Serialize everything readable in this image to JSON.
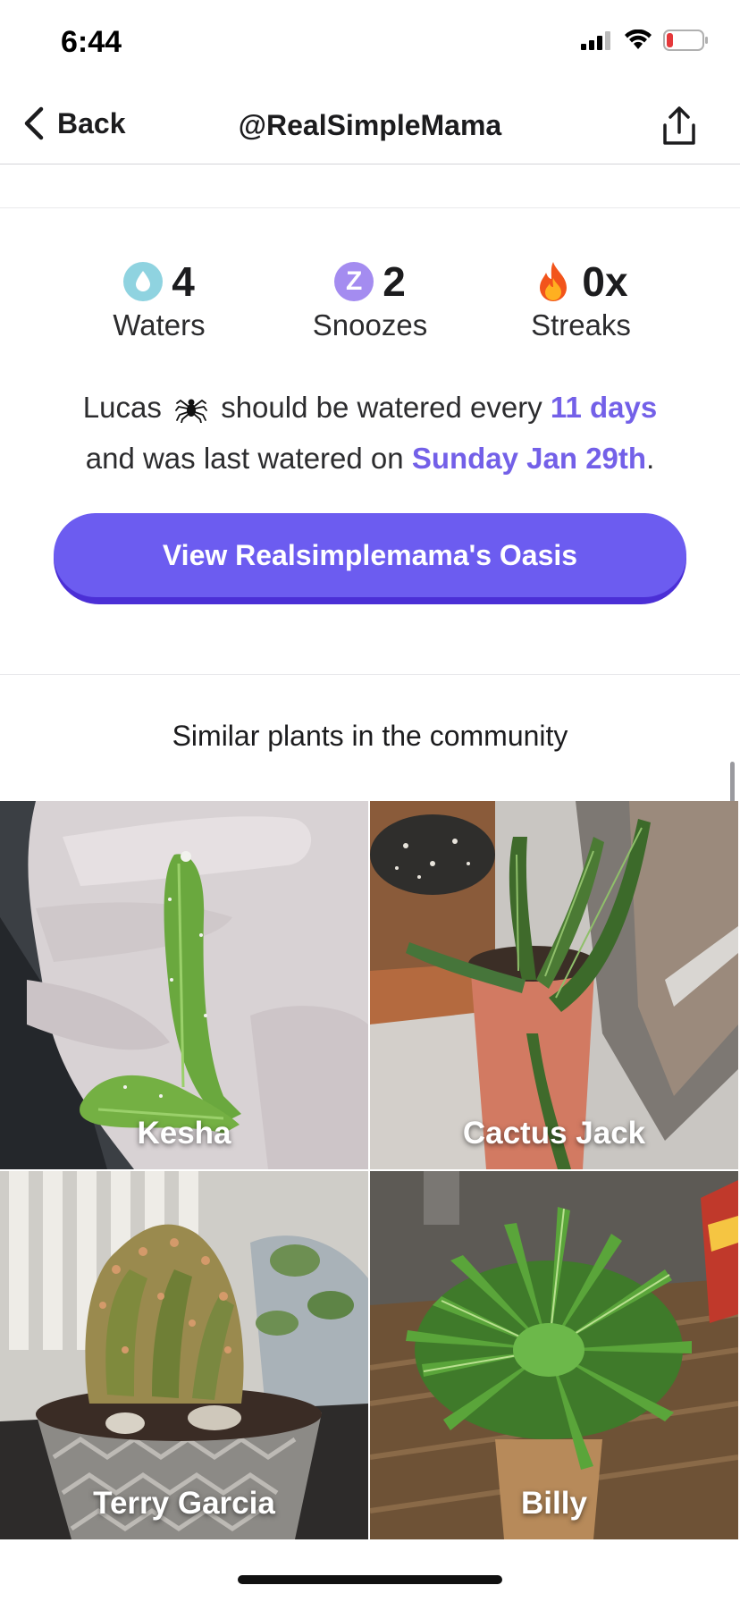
{
  "status_bar": {
    "time": "6:44"
  },
  "nav": {
    "back_label": "Back",
    "title": "@RealSimpleMama"
  },
  "stats": [
    {
      "value": "4",
      "label": "Waters",
      "icon": "water-drop-icon"
    },
    {
      "value": "2",
      "label": "Snoozes",
      "icon": "snooze-z-icon"
    },
    {
      "value": "0x",
      "label": "Streaks",
      "icon": "fire-icon"
    }
  ],
  "description": {
    "plant_name": "Lucas",
    "emoji": "spider-icon",
    "part1": "should be watered every",
    "interval": "11 days",
    "part2": "and was last watered on",
    "last_watered": "Sunday Jan 29th",
    "end": "."
  },
  "cta": {
    "label": "View Realsimplemama's Oasis"
  },
  "similar": {
    "title": "Similar plants in the community",
    "plants": [
      {
        "name": "Kesha"
      },
      {
        "name": "Cactus Jack"
      },
      {
        "name": "Terry Garcia"
      },
      {
        "name": "Billy"
      }
    ]
  },
  "colors": {
    "accent": "#6c5cf0",
    "accent_dark": "#4b2fd6",
    "highlight_text": "#7360e8",
    "water": "#8fd3e0",
    "snooze": "#a48cf0"
  }
}
